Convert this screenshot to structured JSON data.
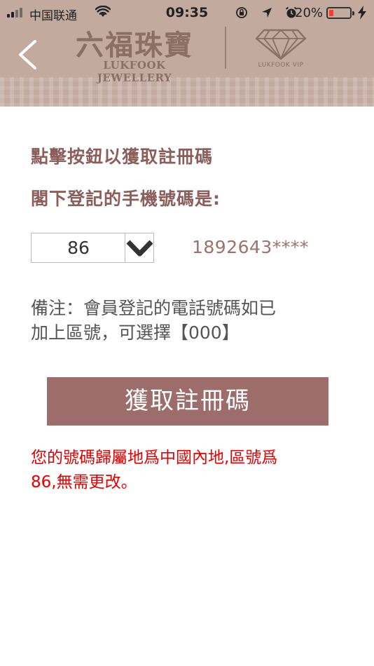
{
  "status_bar": {
    "carrier": "中国联通",
    "time": "09:35",
    "battery_percent": "20%",
    "battery_level": 0.2,
    "battery_color": "#ff3b30"
  },
  "header": {
    "logo_cn": "六福珠寶",
    "logo_en": "LUKFOOK JEWELLERY",
    "vip_label": "LUKFOOK VIP",
    "background_color": "#c2aa9f"
  },
  "main": {
    "instruction": "點擊按鈕以獲取註冊碼",
    "phone_label": "閣下登記的手機號碼是:",
    "country_code": "86",
    "phone_number": "1892643****",
    "note_lines": [
      "備注：會員登記的電話號碼如已",
      "加上區號，可選擇【000】"
    ],
    "button_label": "獲取註冊碼",
    "region_lines": [
      "您的號碼歸屬地爲中國內地,區號爲",
      "86,無需更改。"
    ]
  },
  "colors": {
    "accent": "#9c6d6a",
    "label": "#8c5e5b",
    "error": "#e60000"
  }
}
